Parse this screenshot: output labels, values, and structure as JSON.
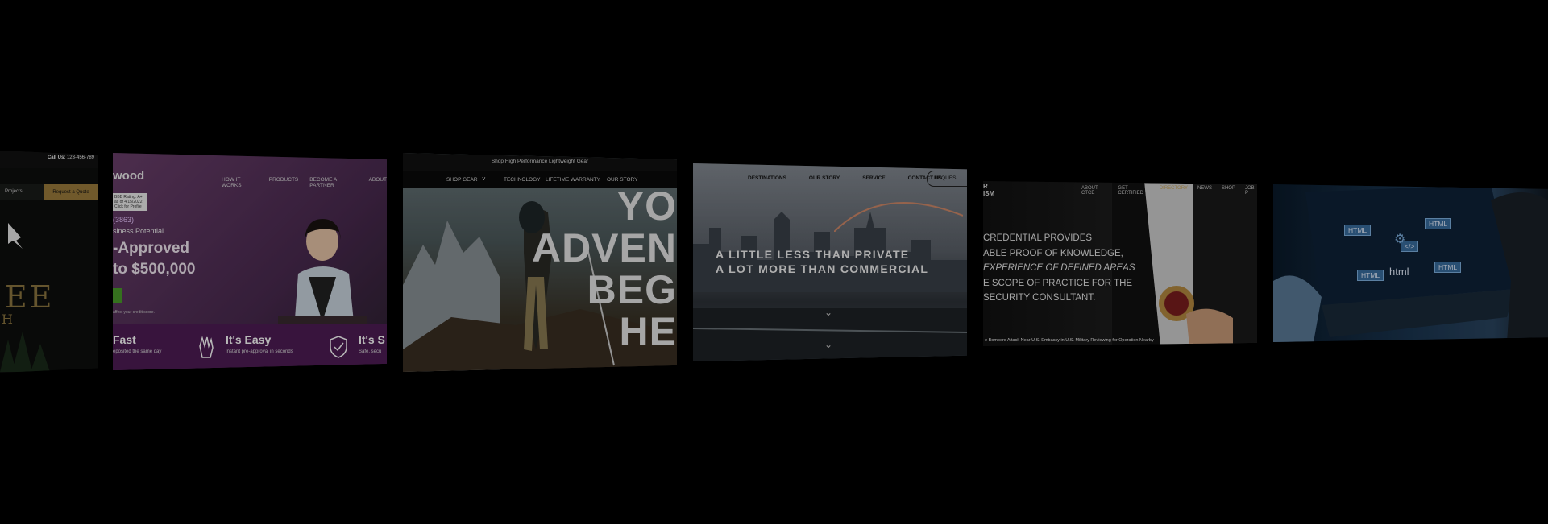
{
  "cards": {
    "construction": {
      "call_label": "Call Us:",
      "phone": "123-456-789",
      "nav_projects": "Projects",
      "quote_button": "Request a Quote",
      "big_letters": "EE",
      "big_letter_small": "H"
    },
    "loans": {
      "logo": "wood",
      "nav": [
        "HOW IT WORKS",
        "PRODUCTS",
        "BECOME A PARTNER",
        "ABOUT"
      ],
      "phone": "(3863)",
      "rating_line1": "BBB Rating: A+",
      "rating_line2": "as of 4/15/2022",
      "rating_line3": "Click for Profile",
      "subhead": "siness Potential",
      "headline_line1": "-Approved",
      "headline_line2": "to $500,000",
      "fine_print": "affect your credit score.",
      "features": [
        {
          "title": "Fast",
          "subtitle": "eposited the same day"
        },
        {
          "title": "It's Easy",
          "subtitle": "Instant pre-approval in seconds"
        },
        {
          "title": "It's S",
          "subtitle": "Safe, secu"
        }
      ]
    },
    "gear": {
      "top_banner": "Shop High Performance Lightweight Gear",
      "nav": [
        "SHOP GEAR",
        "TECHNOLOGY",
        "LIFETIME WARRANTY",
        "OUR STORY"
      ],
      "hero_lines": [
        "YO",
        "ADVEN",
        "BEG",
        "HE"
      ]
    },
    "aviation": {
      "nav": [
        "DESTINATIONS",
        "OUR STORY",
        "SERVICE",
        "CONTACT US"
      ],
      "request_button": "REQUES",
      "headline_line1": "A LITTLE LESS THAN PRIVATE",
      "headline_line2": "A LOT MORE THAN COMMERCIAL"
    },
    "security": {
      "logo_line1": "R",
      "logo_line2": "ISM",
      "nav": [
        "ABOUT CTCE",
        "GET CERTIFIED",
        "DIRECTORY",
        "NEWS",
        "SHOP",
        "JOB P"
      ],
      "active_nav": "DIRECTORY",
      "body_lines": [
        "CREDENTIAL PROVIDES",
        "ABLE PROOF OF KNOWLEDGE,",
        "EXPERIENCE OF DEFINED AREAS",
        "E SCOPE OF PRACTICE FOR THE",
        "SECURITY CONSULTANT."
      ],
      "ticker": "e Bombers Attack Near U.S. Embassy in U.S. Military Reviewing for Operation Nearby"
    },
    "code": {
      "tags": [
        "HTML",
        "HTML",
        "html",
        "HTML",
        "</>",
        "HTML"
      ]
    }
  }
}
